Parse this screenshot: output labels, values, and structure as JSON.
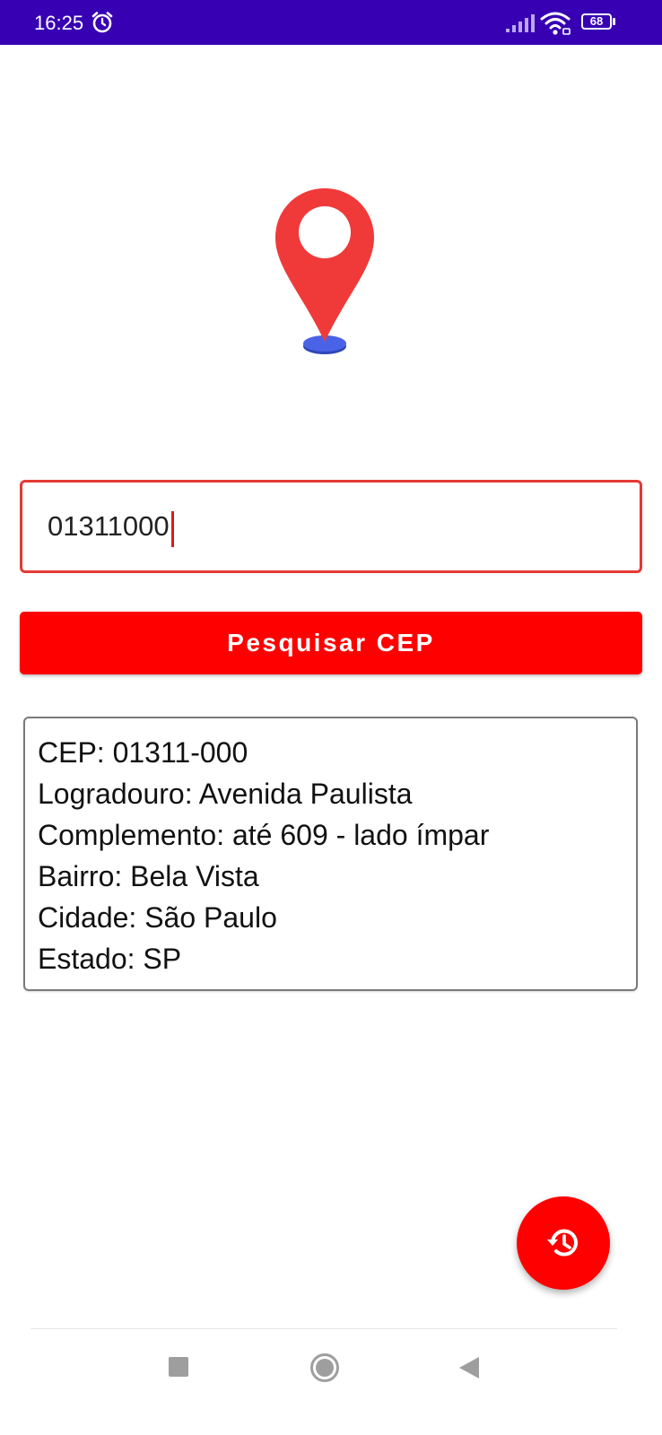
{
  "status_bar": {
    "time": "16:25",
    "battery_level": "68",
    "icons": [
      "alarm-icon",
      "signal-icon",
      "wifi-icon",
      "battery-icon"
    ]
  },
  "logo": {
    "icon": "location-pin-icon",
    "pin_color": "#f03a3a",
    "base_color": "#4a63e6"
  },
  "search": {
    "input_value": "01311000",
    "button_label": "Pesquisar CEP",
    "accent_color": "#ff0000"
  },
  "result": {
    "cep": "CEP: 01311-000",
    "logradouro": "Logradouro: Avenida Paulista",
    "complemento": "Complemento: até 609 - lado ímpar",
    "bairro": "Bairro: Bela Vista",
    "cidade": "Cidade: São Paulo",
    "estado": "Estado: SP"
  },
  "fab": {
    "icon": "history-icon"
  },
  "nav_bar": {
    "icons": [
      "recents-icon",
      "home-icon",
      "back-icon"
    ]
  }
}
